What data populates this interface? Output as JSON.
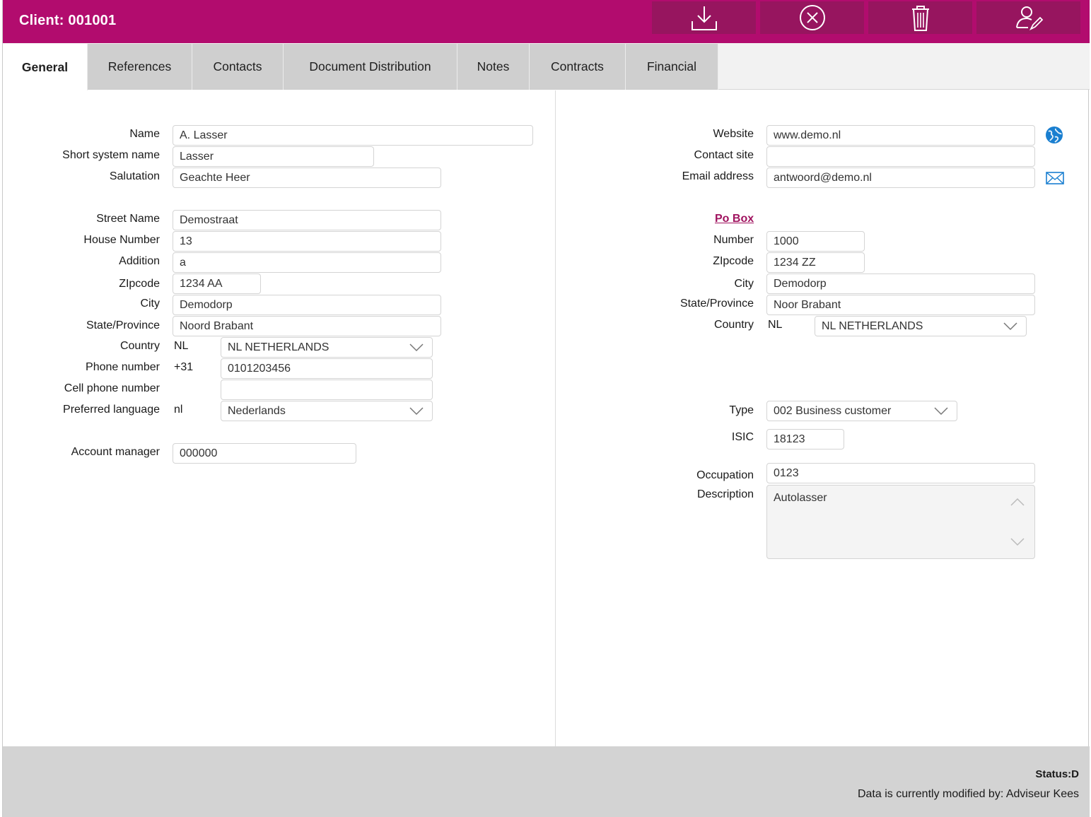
{
  "header": {
    "title": "Client: 001001",
    "buttons": [
      {
        "icon": "download-icon"
      },
      {
        "icon": "cancel-circle-icon"
      },
      {
        "icon": "trash-icon"
      },
      {
        "icon": "user-edit-icon"
      }
    ]
  },
  "tabs": [
    {
      "label": "General",
      "active": true
    },
    {
      "label": "References"
    },
    {
      "label": "Contacts"
    },
    {
      "label": "Document Distribution"
    },
    {
      "label": "Notes"
    },
    {
      "label": "Contracts"
    },
    {
      "label": "Financial"
    }
  ],
  "left": {
    "name": {
      "label": "Name",
      "value": "A. Lasser"
    },
    "short_name": {
      "label": "Short system name",
      "value": "Lasser"
    },
    "salutation": {
      "label": "Salutation",
      "value": "Geachte Heer"
    },
    "street": {
      "label": "Street Name",
      "value": "Demostraat"
    },
    "house_number": {
      "label": "House Number",
      "value": "13"
    },
    "addition": {
      "label": "Addition",
      "value": "a"
    },
    "zipcode": {
      "label": "ZIpcode",
      "value": "1234 AA"
    },
    "city": {
      "label": "City",
      "value": "Demodorp"
    },
    "state": {
      "label": "State/Province",
      "value": "Noord Brabant"
    },
    "country": {
      "label": "Country",
      "code": "NL",
      "value": "NL NETHERLANDS"
    },
    "phone": {
      "label": "Phone number",
      "prefix": "+31",
      "value": "0101203456"
    },
    "cell": {
      "label": "Cell phone number",
      "value": ""
    },
    "language": {
      "label": "Preferred language",
      "code": "nl",
      "value": "Nederlands"
    },
    "account_manager": {
      "label": "Account manager",
      "value": "000000"
    }
  },
  "right": {
    "website": {
      "label": "Website",
      "value": "www.demo.nl",
      "icon": "globe-icon"
    },
    "contact_site": {
      "label": "Contact site",
      "value": ""
    },
    "email": {
      "label": "Email address",
      "value": "antwoord@demo.nl",
      "icon": "envelope-icon"
    },
    "po_box_link": "Po Box",
    "number": {
      "label": "Number",
      "value": "1000"
    },
    "zipcode": {
      "label": "ZIpcode",
      "value": "1234 ZZ"
    },
    "city": {
      "label": "City",
      "value": "Demodorp"
    },
    "state": {
      "label": "State/Province",
      "value": "Noor Brabant"
    },
    "country": {
      "label": "Country",
      "code": "NL",
      "value": "NL NETHERLANDS"
    },
    "type": {
      "label": "Type",
      "value": "002 Business customer"
    },
    "isic": {
      "label": "ISIC",
      "value": "18123"
    },
    "occupation": {
      "label": "Occupation",
      "value": "0123"
    },
    "description": {
      "label": "Description",
      "value": "Autolasser"
    }
  },
  "footer": {
    "status": "Status:D",
    "modified_by": "Data is currently modified by: Adviseur Kees"
  },
  "colors": {
    "brand": "#b20c6e",
    "header_button": "#97155f",
    "link": "#a0135f",
    "icon_blue": "#1a7fd0"
  }
}
